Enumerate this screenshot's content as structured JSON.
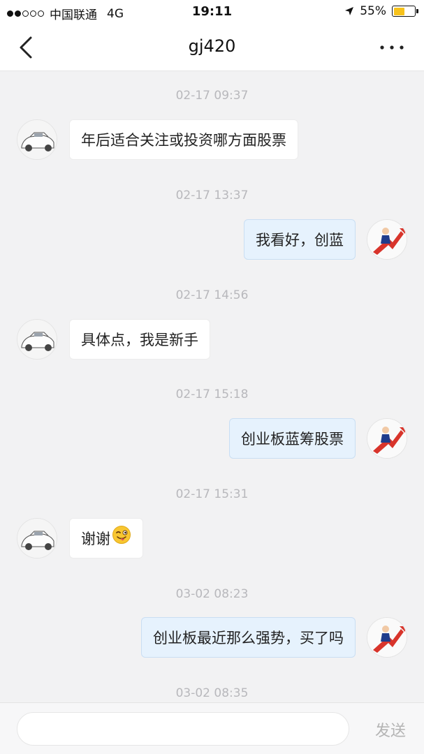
{
  "status_bar": {
    "carrier": "中国联通",
    "network": "4G",
    "time": "19:11",
    "battery": "55%",
    "battery_level": 0.55,
    "signal_bars_filled": 2,
    "signal_bars_total": 5
  },
  "header": {
    "title": "gj420",
    "back_icon": "chevron-left-icon",
    "more_icon": "more-dots-icon"
  },
  "messages": [
    {
      "timestamp": "02-17 09:37",
      "direction": "in",
      "text": "年后适合关注或投资哪方面股票"
    },
    {
      "timestamp": "02-17 13:37",
      "direction": "out",
      "text": "我看好，创蓝"
    },
    {
      "timestamp": "02-17 14:56",
      "direction": "in",
      "text": "具体点，我是新手"
    },
    {
      "timestamp": "02-17 15:18",
      "direction": "out",
      "text": "创业板蓝筹股票"
    },
    {
      "timestamp": "02-17 15:31",
      "direction": "in",
      "text": "谢谢",
      "emoji": "winking-tongue-emoji"
    },
    {
      "timestamp": "03-02 08:23",
      "direction": "out",
      "text": "创业板最近那么强势，买了吗"
    },
    {
      "timestamp": "03-02 08:35",
      "direction": "",
      "text": ""
    }
  ],
  "input": {
    "placeholder": "",
    "send_label": "发送"
  },
  "colors": {
    "outgoing_bubble": "#e6f2fd",
    "incoming_bubble": "#ffffff",
    "background": "#f2f2f3",
    "timestamp": "#b8b8bc",
    "battery": "#f7c21b"
  }
}
